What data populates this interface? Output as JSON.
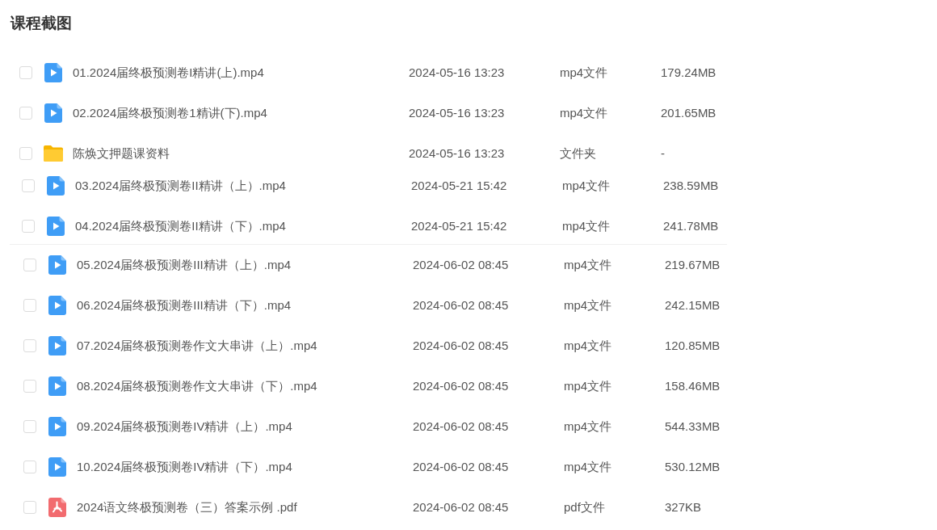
{
  "title": "课程截图",
  "file_groups": [
    {
      "files": [
        {
          "kind": "video",
          "checked": false,
          "name": "01.2024届终极预测卷I精讲(上).mp4",
          "modified": "2024-05-16 13:23",
          "type": "mp4文件",
          "size": "179.24MB"
        },
        {
          "kind": "video",
          "checked": false,
          "name": "02.2024届终极预测卷1精讲(下).mp4",
          "modified": "2024-05-16 13:23",
          "type": "mp4文件",
          "size": "201.65MB"
        },
        {
          "kind": "folder",
          "checked": false,
          "name": "陈焕文押题课资料",
          "modified": "2024-05-16 13:23",
          "type": "文件夹",
          "size": "-"
        }
      ]
    },
    {
      "files": [
        {
          "kind": "video",
          "checked": false,
          "name": "03.2024届终极预测卷II精讲（上）.mp4",
          "modified": "2024-05-21 15:42",
          "type": "mp4文件",
          "size": "238.59MB"
        },
        {
          "kind": "video",
          "checked": false,
          "name": "04.2024届终极预测卷II精讲（下）.mp4",
          "modified": "2024-05-21 15:42",
          "type": "mp4文件",
          "size": "241.78MB"
        }
      ]
    },
    {
      "files": [
        {
          "kind": "video",
          "checked": false,
          "name": "05.2024届终极预测卷III精讲（上）.mp4",
          "modified": "2024-06-02 08:45",
          "type": "mp4文件",
          "size": "219.67MB"
        },
        {
          "kind": "video",
          "checked": false,
          "name": "06.2024届终极预测卷III精讲（下）.mp4",
          "modified": "2024-06-02 08:45",
          "type": "mp4文件",
          "size": "242.15MB"
        },
        {
          "kind": "video",
          "checked": false,
          "name": "07.2024届终极预测卷作文大串讲（上）.mp4",
          "modified": "2024-06-02 08:45",
          "type": "mp4文件",
          "size": "120.85MB"
        },
        {
          "kind": "video",
          "checked": false,
          "name": "08.2024届终极预测卷作文大串讲（下）.mp4",
          "modified": "2024-06-02 08:45",
          "type": "mp4文件",
          "size": "158.46MB"
        },
        {
          "kind": "video",
          "checked": false,
          "name": "09.2024届终极预测卷IV精讲（上）.mp4",
          "modified": "2024-06-02 08:45",
          "type": "mp4文件",
          "size": "544.33MB"
        },
        {
          "kind": "video",
          "checked": false,
          "name": "10.2024届终极预测卷IV精讲（下）.mp4",
          "modified": "2024-06-02 08:45",
          "type": "mp4文件",
          "size": "530.12MB"
        },
        {
          "kind": "pdf",
          "checked": false,
          "name": "2024语文终极预测卷（三）答案示例 .pdf",
          "modified": "2024-06-02 08:45",
          "type": "pdf文件",
          "size": "327KB"
        }
      ]
    }
  ]
}
